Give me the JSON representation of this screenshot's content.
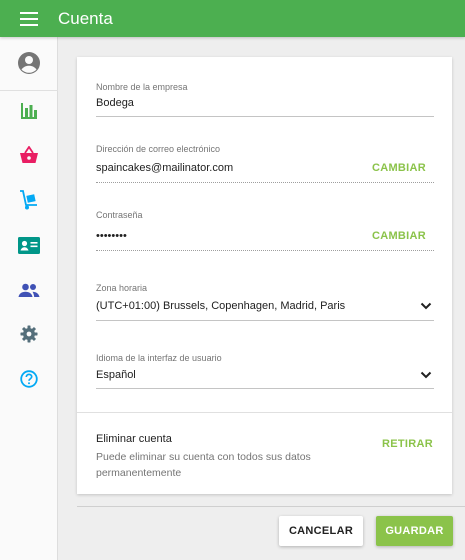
{
  "app": {
    "title": "Cuenta",
    "menu_icon": "hamburger-menu-icon"
  },
  "sidebar": {
    "items": [
      {
        "name": "profile",
        "icon": "account-circle-icon",
        "color": "#757575"
      },
      {
        "name": "reports",
        "icon": "bar-chart-icon",
        "color": "#4caf50"
      },
      {
        "name": "sales",
        "icon": "shopping-basket-icon",
        "color": "#e91e63"
      },
      {
        "name": "purchases",
        "icon": "hand-truck-icon",
        "color": "#03a9f4"
      },
      {
        "name": "contacts",
        "icon": "contact-card-icon",
        "color": "#009688"
      },
      {
        "name": "users",
        "icon": "people-icon",
        "color": "#3f51b5"
      },
      {
        "name": "settings",
        "icon": "gear-icon",
        "color": "#546e7a"
      },
      {
        "name": "help",
        "icon": "help-circle-icon",
        "color": "#03a9f4"
      }
    ]
  },
  "form": {
    "company": {
      "label": "Nombre de la empresa",
      "value": "Bodega"
    },
    "email": {
      "label": "Dirección de correo electrónico",
      "value": "spaincakes@mailinator.com",
      "action": "CAMBIAR"
    },
    "password": {
      "label": "Contraseña",
      "value": "••••••••",
      "action": "CAMBIAR"
    },
    "timezone": {
      "label": "Zona horaria",
      "value": "(UTC+01:00) Brussels, Copenhagen, Madrid, Paris"
    },
    "language": {
      "label": "Idioma de la interfaz de usuario",
      "value": "Español"
    }
  },
  "delete_account": {
    "title": "Eliminar cuenta",
    "description": "Puede eliminar su cuenta con todos sus datos permanentemente",
    "action": "RETIRAR"
  },
  "footer": {
    "cancel_label": "CANCELAR",
    "save_label": "GUARDAR"
  },
  "colors": {
    "primary": "#4caf50",
    "accent": "#8bc34a"
  }
}
